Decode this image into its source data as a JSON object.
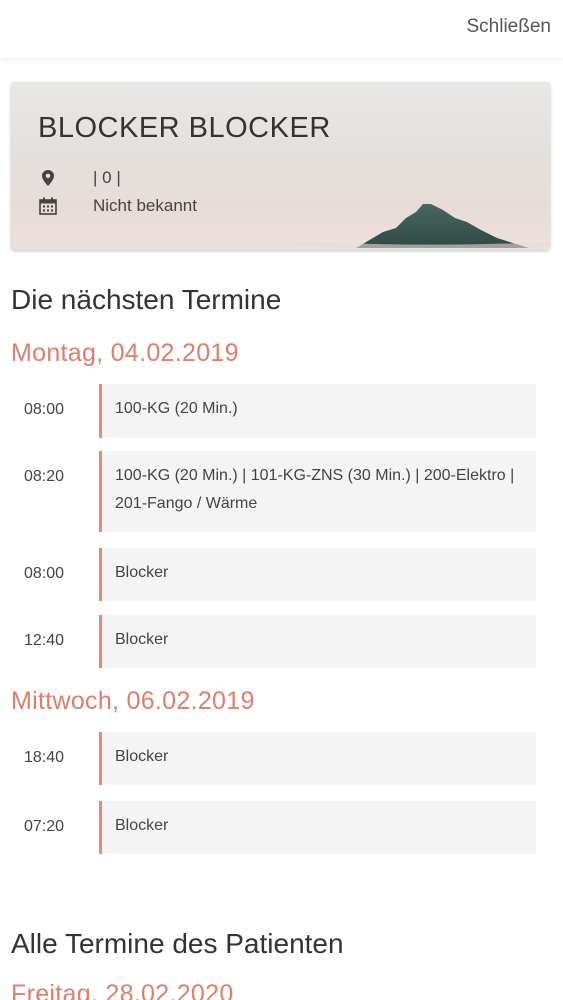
{
  "header": {
    "close_label": "Schließen"
  },
  "patient": {
    "name": "BLOCKER BLOCKER",
    "location": "| 0 |",
    "birthdate": "Nicht bekannt"
  },
  "upcoming": {
    "title": "Die nächsten Termine",
    "days": [
      {
        "date": "Montag, 04.02.2019",
        "appointments": [
          {
            "time": "08:00",
            "description": "100-KG (20 Min.)"
          },
          {
            "time": "08:20",
            "description": "100-KG (20 Min.) | 101-KG-ZNS (30 Min.) | 200-Elektro | 201-Fango / Wärme"
          },
          {
            "time": "08:00",
            "description": "Blocker"
          },
          {
            "time": "12:40",
            "description": "Blocker"
          }
        ]
      },
      {
        "date": "Mittwoch, 06.02.2019",
        "appointments": [
          {
            "time": "18:40",
            "description": "Blocker"
          },
          {
            "time": "07:20",
            "description": "Blocker"
          }
        ]
      }
    ]
  },
  "all": {
    "title": "Alle Termine des Patienten",
    "days": [
      {
        "date": "Freitag, 28.02.2020"
      }
    ]
  },
  "colors": {
    "accent": "#e07e6a",
    "card_bg": "#f4f4f4",
    "border_accent": "#e58a78"
  }
}
